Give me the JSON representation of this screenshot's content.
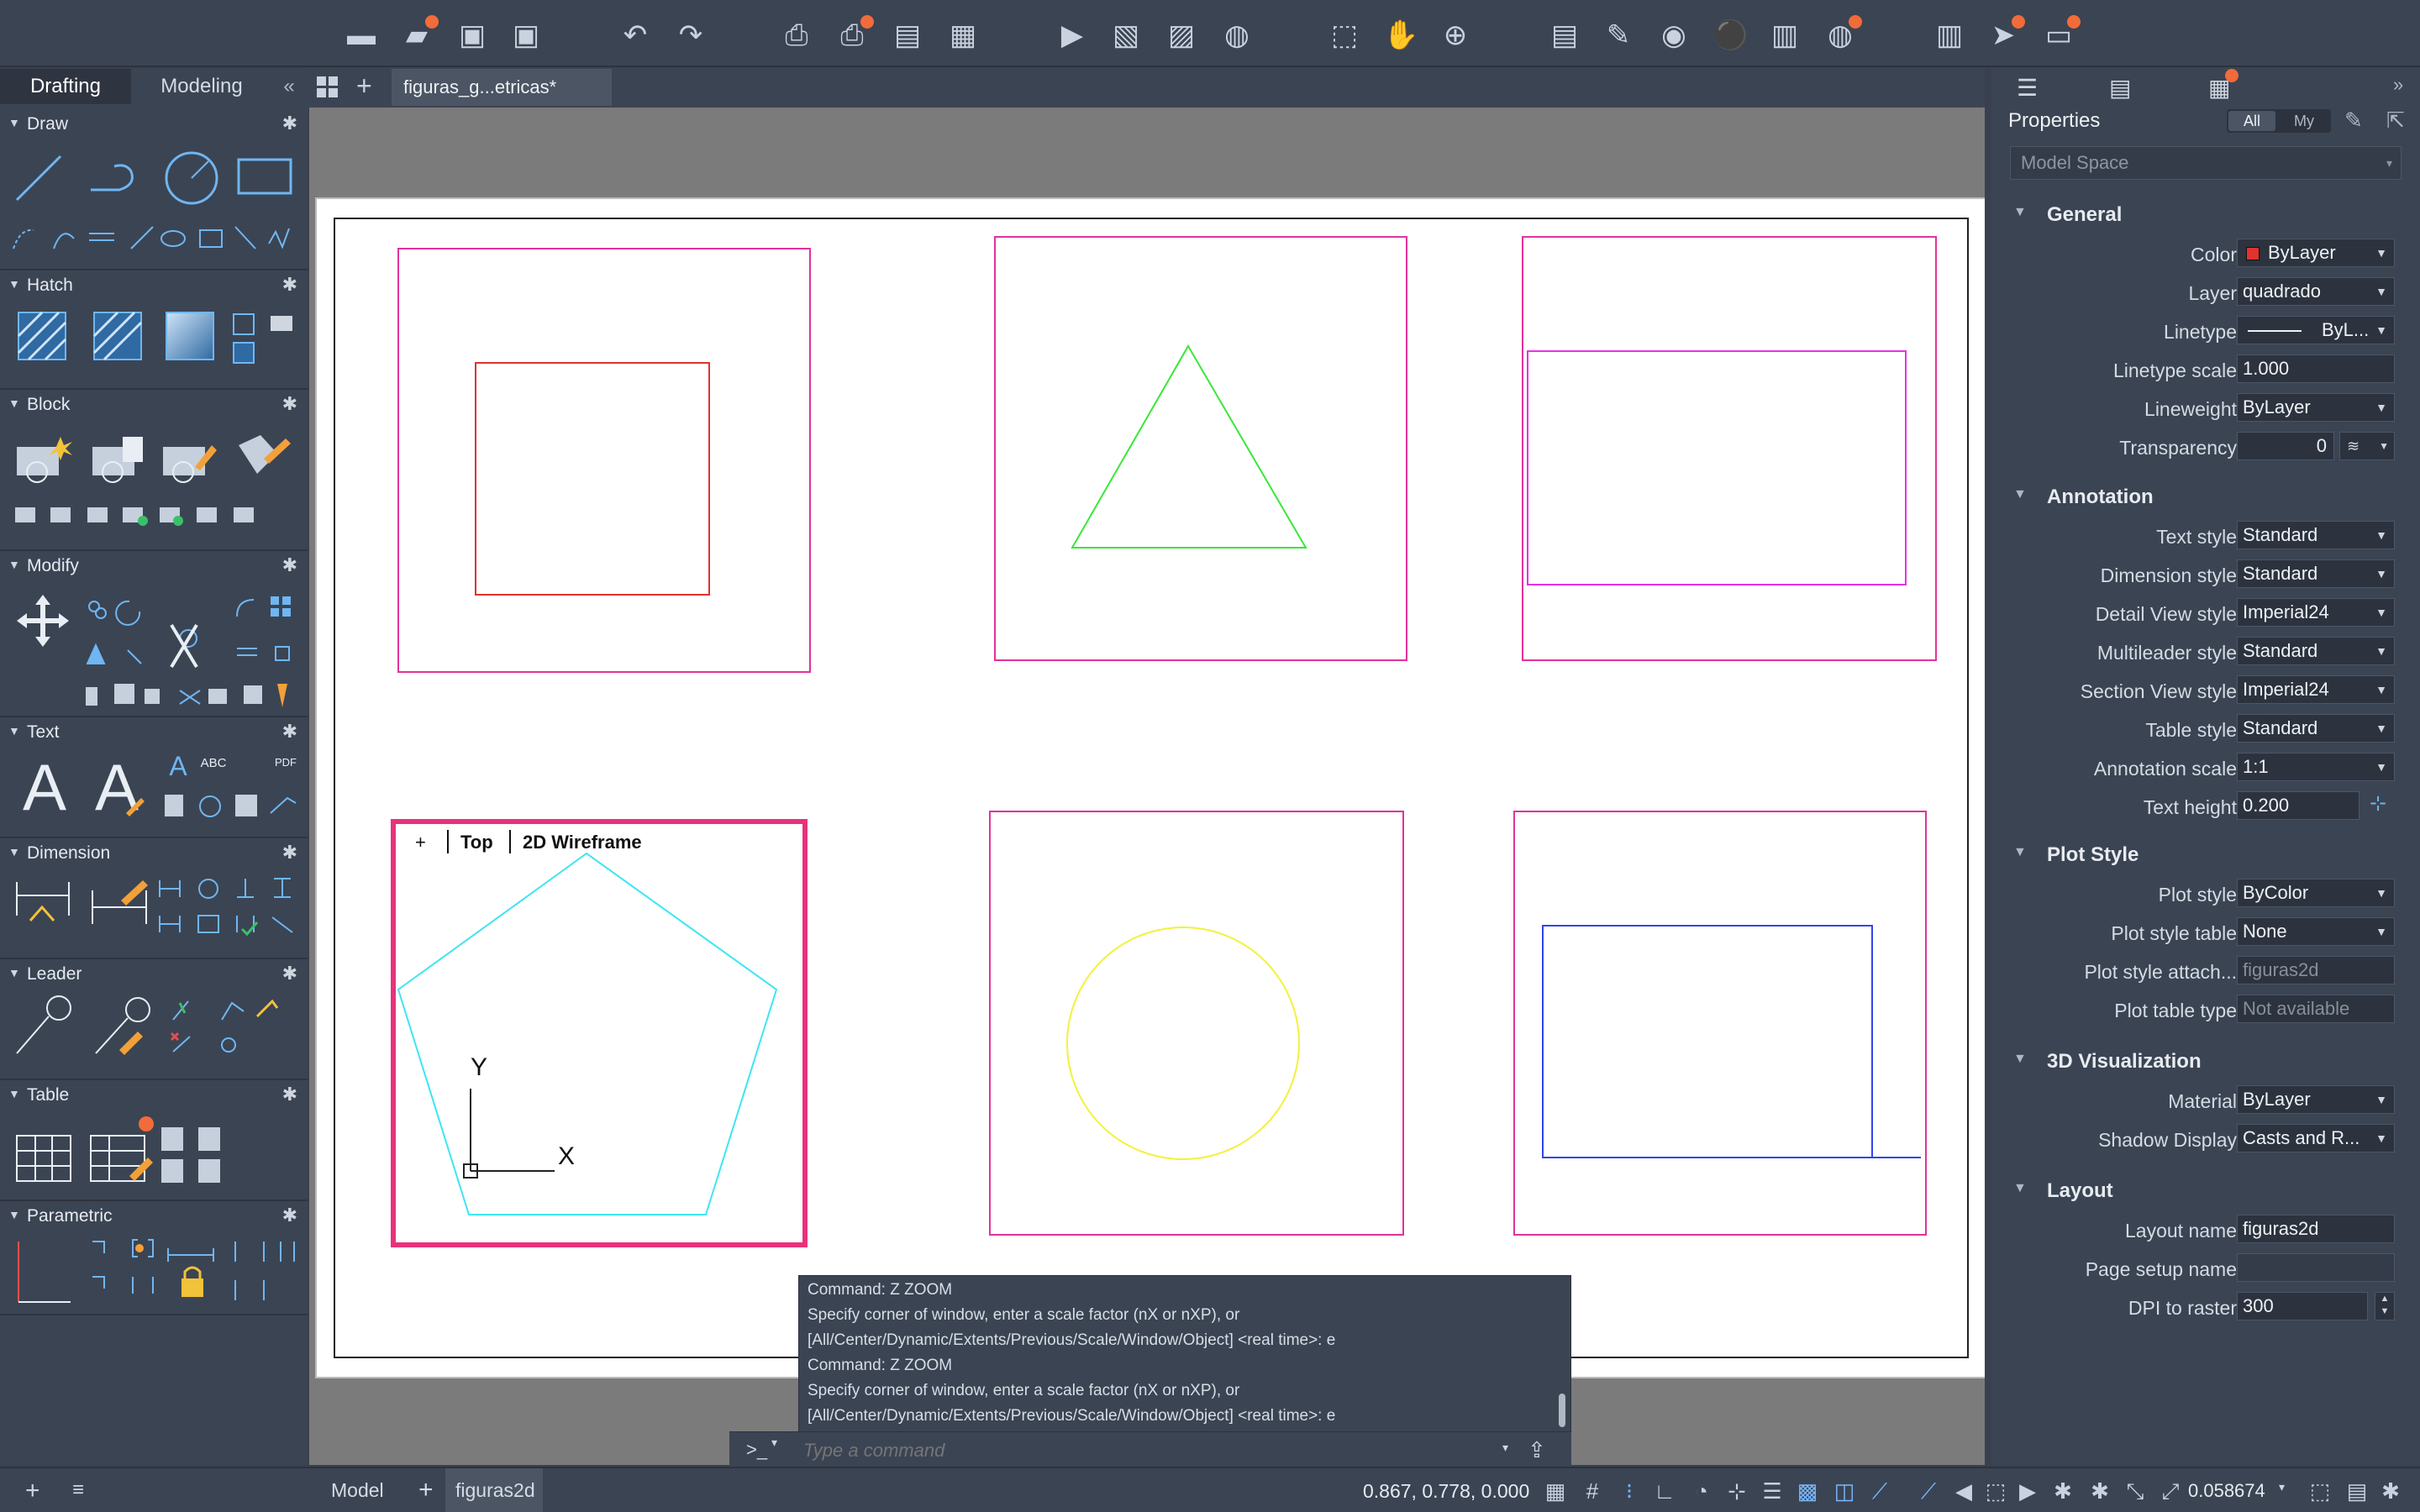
{
  "workspace_tabs": {
    "drafting": "Drafting",
    "modeling": "Modeling",
    "collapse": "«"
  },
  "document": {
    "tab_title": "figuras_g...etricas*",
    "new_tab": "+"
  },
  "palette": {
    "sections": [
      {
        "name": "Draw"
      },
      {
        "name": "Hatch"
      },
      {
        "name": "Block"
      },
      {
        "name": "Modify"
      },
      {
        "name": "Text"
      },
      {
        "name": "Dimension"
      },
      {
        "name": "Leader"
      },
      {
        "name": "Table"
      },
      {
        "name": "Parametric"
      }
    ],
    "text_tools": {
      "single_line_text": "A",
      "abc_label": "ABC",
      "pdf_label": "PDF"
    }
  },
  "viewport": {
    "plus": "+",
    "view_name": "Top",
    "visual_style": "2D Wireframe",
    "ucs_y": "Y",
    "ucs_x": "X"
  },
  "shape_colors": {
    "frame": "#e0339a",
    "square": "#e0332f",
    "triangle": "#38e838",
    "rectangle": "#e433e4",
    "pentagon": "#3de6f2",
    "circle": "#f2f23a",
    "blue_rect": "#3344ee",
    "active_viewport_border": "#e8327a"
  },
  "command_line": {
    "history": [
      "Command: Z ZOOM",
      "Specify corner of window, enter a scale factor (nX or nXP), or",
      "[All/Center/Dynamic/Extents/Previous/Scale/Window/Object] <real time>: e",
      "Command: Z ZOOM",
      "Specify corner of window, enter a scale factor (nX or nXP), or",
      "[All/Center/Dynamic/Extents/Previous/Scale/Window/Object] <real time>: e"
    ],
    "prompt_icon": ">_",
    "placeholder": "Type a command"
  },
  "properties": {
    "title": "Properties",
    "filter_all": "All",
    "filter_my": "My",
    "space": "Model Space",
    "groups": {
      "general": "General",
      "annotation": "Annotation",
      "plot_style": "Plot Style",
      "visualization": "3D Visualization",
      "layout": "Layout"
    },
    "general": [
      {
        "label": "Color",
        "value": "ByLayer"
      },
      {
        "label": "Layer",
        "value": "quadrado"
      },
      {
        "label": "Linetype",
        "value": "ByL..."
      },
      {
        "label": "Linetype scale",
        "value": "1.000"
      },
      {
        "label": "Lineweight",
        "value": "ByLayer"
      },
      {
        "label": "Transparency",
        "value": "0"
      }
    ],
    "annotation": [
      {
        "label": "Text style",
        "value": "Standard"
      },
      {
        "label": "Dimension style",
        "value": "Standard"
      },
      {
        "label": "Detail View style",
        "value": "Imperial24"
      },
      {
        "label": "Multileader style",
        "value": "Standard"
      },
      {
        "label": "Section View style",
        "value": "Imperial24"
      },
      {
        "label": "Table style",
        "value": "Standard"
      },
      {
        "label": "Annotation scale",
        "value": "1:1"
      },
      {
        "label": "Text height",
        "value": "0.200"
      }
    ],
    "plot_style": [
      {
        "label": "Plot style",
        "value": "ByColor"
      },
      {
        "label": "Plot style table",
        "value": "None"
      },
      {
        "label": "Plot style attach...",
        "value": "figuras2d"
      },
      {
        "label": "Plot table type",
        "value": "Not available"
      }
    ],
    "visualization": [
      {
        "label": "Material",
        "value": "ByLayer"
      },
      {
        "label": "Shadow Display",
        "value": "Casts and R..."
      }
    ],
    "layout": [
      {
        "label": "Layout name",
        "value": "figuras2d"
      },
      {
        "label": "Page setup name",
        "value": ""
      },
      {
        "label": "DPI to raster",
        "value": "300"
      }
    ],
    "color_swatch": "#e0332f"
  },
  "status_bar": {
    "model_tab": "Model",
    "add_layout": "+",
    "layout_tab": "figuras2d",
    "coordinates": "0.867, 0.778, 0.000",
    "annotation_scale": "0.058674"
  }
}
